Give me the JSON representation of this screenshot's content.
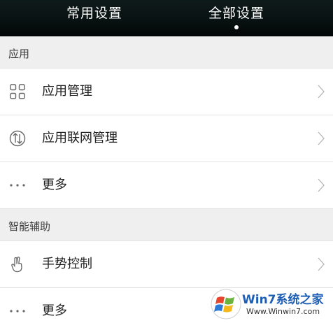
{
  "tabs": [
    {
      "label": "常用设置",
      "active": false
    },
    {
      "label": "全部设置",
      "active": true
    }
  ],
  "sections": [
    {
      "title": "应用",
      "items": [
        {
          "label": "应用管理",
          "icon": "grid-icon"
        },
        {
          "label": "应用联网管理",
          "icon": "network-arrows-icon"
        },
        {
          "label": "更多",
          "icon": "more-dots-icon"
        }
      ]
    },
    {
      "title": "智能辅助",
      "items": [
        {
          "label": "手势控制",
          "icon": "hand-gesture-icon"
        },
        {
          "label": "更多",
          "icon": "more-dots-icon"
        }
      ]
    }
  ],
  "watermark": {
    "text": "Win7系统之家",
    "url": "Www.Winwin7.com",
    "icon": "windows-logo-icon"
  },
  "colors": {
    "header_bg": "#0a1414",
    "section_bg": "#efefef",
    "watermark_blue": "#1e5fb3"
  }
}
